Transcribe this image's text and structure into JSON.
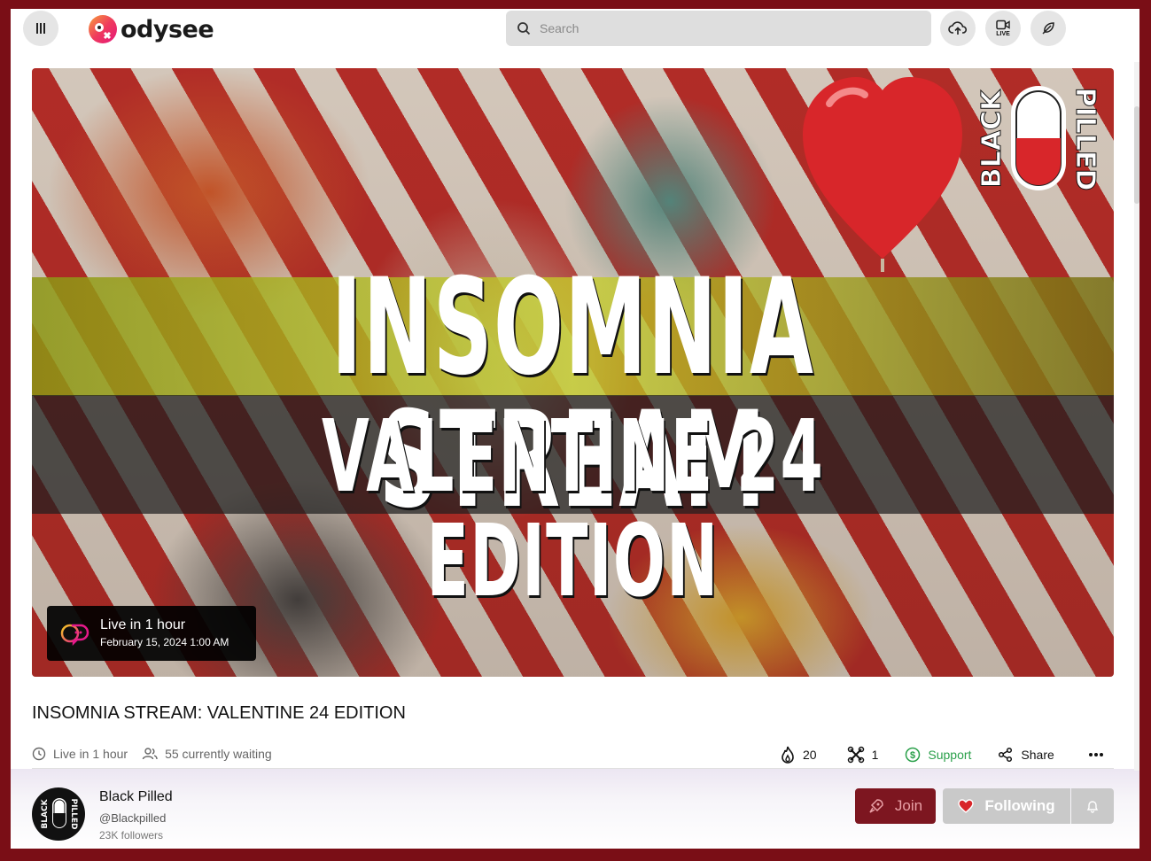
{
  "header": {
    "logo_text": "odysee",
    "search_placeholder": "Search",
    "live_tag": "LIVE",
    "menu_icon": "menu-icon",
    "upload_icon": "upload-cloud-icon",
    "go_live_icon": "video-camera-icon",
    "post_icon": "feather-icon"
  },
  "hero": {
    "title_line1": "INSOMNIA STREAM",
    "title_line2": "VALENTINE 24 EDITION",
    "brand_logo_left": "BLACK",
    "brand_logo_right": "PILLED",
    "live_badge": {
      "status": "Live in 1 hour",
      "datetime": "February 15, 2024 1:00 AM"
    }
  },
  "video": {
    "title": "INSOMNIA STREAM: VALENTINE 24 EDITION",
    "live_status": "Live in 1 hour",
    "waiting": "55 currently waiting"
  },
  "actions": {
    "fire_count": "20",
    "slime_count": "1",
    "support_label": "Support",
    "share_label": "Share",
    "fire_ratio": 1.0
  },
  "channel": {
    "name": "Black Pilled",
    "handle": "@Blackpilled",
    "followers": "23K followers",
    "avatar_left": "BLACK",
    "avatar_right": "PILLED",
    "join_label": "Join",
    "following_label": "Following"
  },
  "colors": {
    "outer_border": "#7a0e16",
    "join_bg": "#7d1620",
    "support_green": "#2aa04a",
    "fire_red": "#d63a3a"
  }
}
